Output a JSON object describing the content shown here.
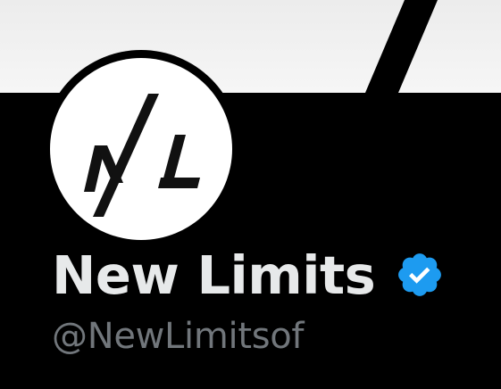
{
  "profile": {
    "display_name": "New Limits",
    "handle": "@NewLimitsof",
    "verified_icon": "verified-badge-icon",
    "avatar_monogram": "NL"
  },
  "colors": {
    "background": "#000000",
    "banner": "#f0f0f0",
    "display_name": "#e7e9ea",
    "handle": "#71767b",
    "verified_badge": "#1d9bf0"
  }
}
